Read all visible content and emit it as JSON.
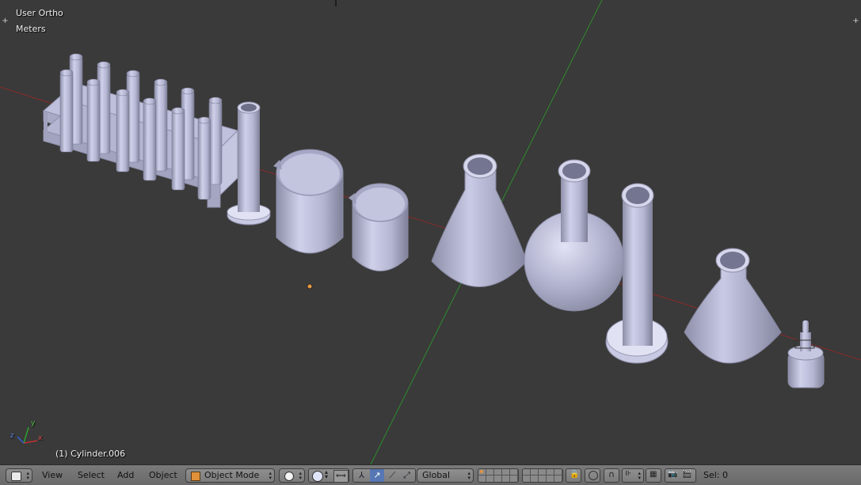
{
  "viewport": {
    "view_name": "User Ortho",
    "units": "Meters",
    "selected_object": "(1) Cylinder.006",
    "axis_x_label": "x",
    "axis_y_label": "y",
    "axis_z_label": "z"
  },
  "header": {
    "menus": [
      "View",
      "Select",
      "Add",
      "Object"
    ],
    "mode": "Object Mode",
    "orientation": "Global",
    "selection_status": "Sel: 0"
  },
  "colors": {
    "background": "#3a3a3a",
    "x_axis": "#8b2a2a",
    "y_axis": "#2e8b2e",
    "object": "#b8b9d6",
    "header": "#727272"
  }
}
